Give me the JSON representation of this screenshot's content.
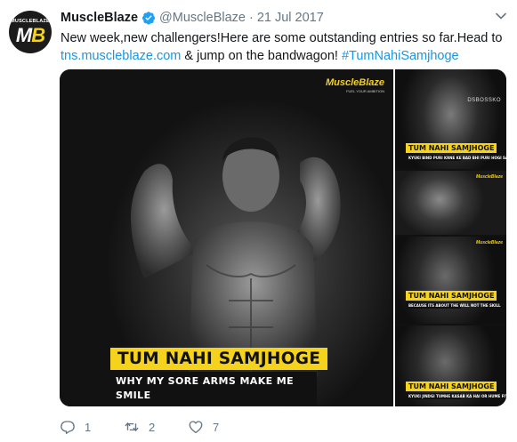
{
  "author": {
    "display_name": "MuscleBlaze",
    "handle": "@MuscleBlaze",
    "separator": "·",
    "date": "21 Jul 2017",
    "avatar_brand": "MUSCLEBLAZE",
    "avatar_monogram_m": "M",
    "avatar_monogram_b": "B"
  },
  "tweet": {
    "text_line1": "New week,new challengers!Here are some outstanding entries so far.Head to",
    "link_url": "tns.muscleblaze.com",
    "text_mid": " & jump on the bandwagon! ",
    "hashtag": "#TumNahiSamjhoge"
  },
  "media": {
    "main": {
      "logo": "MuscleBlaze",
      "logo_sub": "FUEL YOUR AMBITION",
      "caption_title": "TUM NAHI SAMJHOGE",
      "caption_sub_line1": "WHY MY SORE ARMS MAKE ME",
      "caption_sub_line2": "SMILE"
    },
    "thumbs": [
      {
        "watermark": "DSBOSSKO",
        "title": "TUM NAHI SAMJHOGE",
        "sub": "KYUKI BIND PURI KRNE KE BAD BHI PURI HOGI SAPNE NHI"
      },
      {
        "title": "",
        "sub": ""
      },
      {
        "title": "TUM NAHI SAMJHOGE",
        "sub": "BECAUSE ITS ABOUT THE WILL NOT THE SKILL"
      },
      {
        "title": "TUM NAHI SAMJHOGE",
        "sub": "KYUKI JINDGI TUMHE KASAB KA HAI OR HUME FITNESS KA"
      }
    ],
    "thumb_logo": "MuscleBlaze"
  },
  "actions": {
    "reply_count": "1",
    "retweet_count": "2",
    "like_count": "7"
  },
  "colors": {
    "link": "#1b95e0",
    "brand_yellow": "#f5d21b",
    "muted": "#657786"
  }
}
